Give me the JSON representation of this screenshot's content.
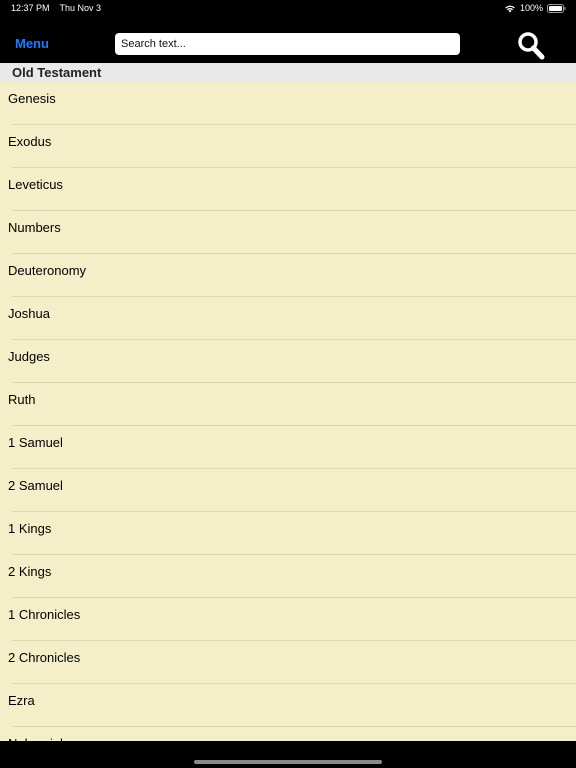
{
  "status_bar": {
    "time": "12:37 PM",
    "date": "Thu Nov 3",
    "battery": "100%"
  },
  "nav": {
    "menu_label": "Menu",
    "search_placeholder": "Search text...",
    "accent_color": "#1a7cff"
  },
  "section": {
    "title": "Old Testament"
  },
  "books": [
    "Genesis",
    "Exodus",
    "Leveticus",
    "Numbers",
    "Deuteronomy",
    "Joshua",
    "Judges",
    "Ruth",
    "1 Samuel",
    "2 Samuel",
    "1 Kings",
    "2 Kings",
    "1 Chronicles",
    "2 Chronicles",
    "Ezra",
    "Nehemiah"
  ],
  "icons": {
    "wifi": "wifi-icon",
    "battery": "battery-icon",
    "search": "magnifier-icon"
  }
}
